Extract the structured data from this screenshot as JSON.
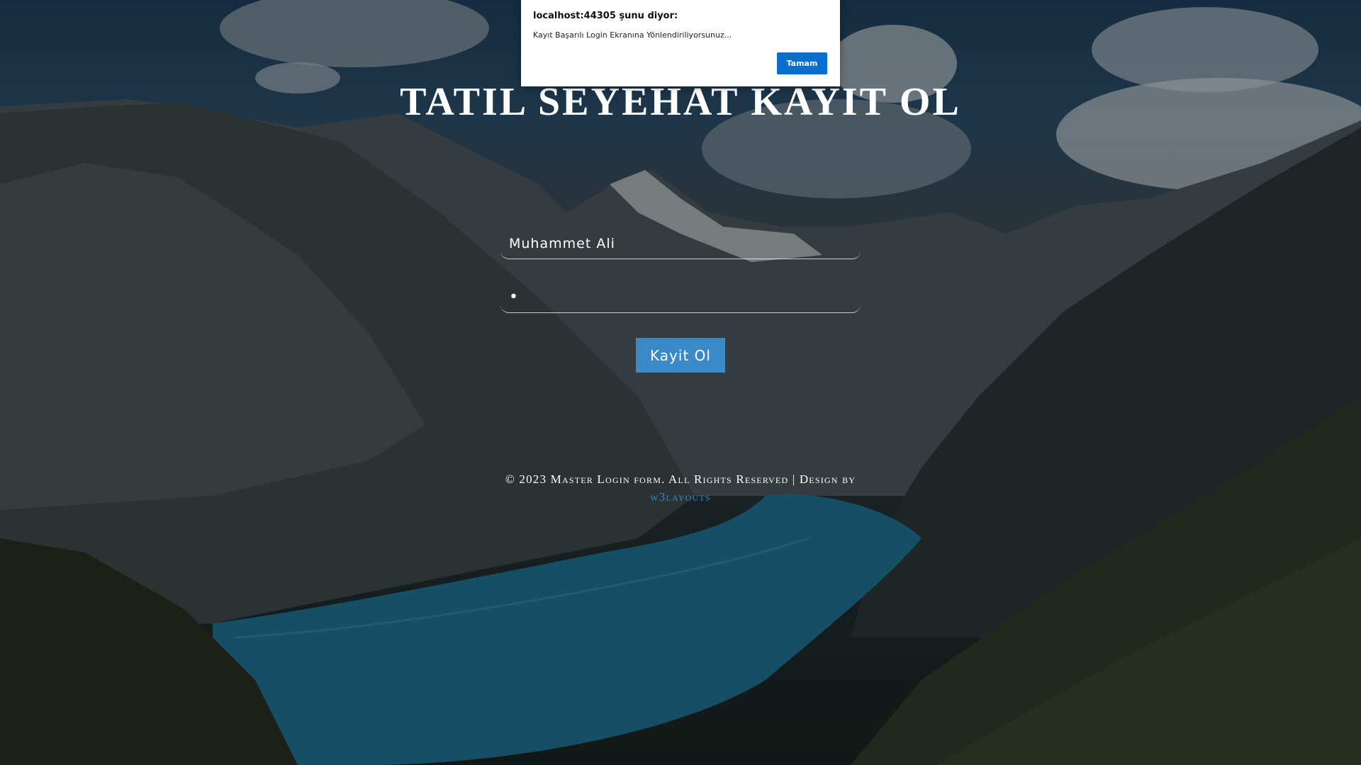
{
  "page": {
    "title": "TATIL SEYEHAT KAYIT OL"
  },
  "form": {
    "name_value": "Muhammet Ali",
    "password_value": "•",
    "submit_label": "Kayit Ol"
  },
  "footer": {
    "text": "© 2023 Master Login form. All Rights Reserved | Design by",
    "link_text": "w3layouts",
    "link_color": "#2f8be0"
  },
  "dialog": {
    "title": "localhost:44305 şunu diyor:",
    "message": "Kayıt Başarılı Login Ekranına Yönlendiriliyorsunuz...",
    "ok_label": "Tamam",
    "ok_color": "#0a6ed1"
  },
  "colors": {
    "submit_button": "#3a8ac9",
    "lake": "#1f6e8c"
  }
}
